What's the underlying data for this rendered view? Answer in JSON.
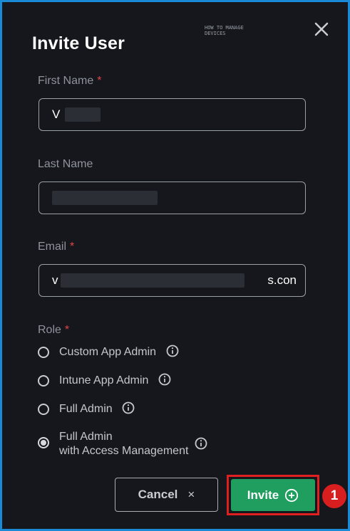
{
  "dialog": {
    "title": "Invite User",
    "watermark": "HOW TO MANAGE DEVICES"
  },
  "form": {
    "first_name": {
      "label": "First Name",
      "required_mark": "*",
      "value": "V"
    },
    "last_name": {
      "label": "Last Name",
      "required_mark": "",
      "value": ""
    },
    "email": {
      "label": "Email",
      "required_mark": "*",
      "value": "v",
      "value_tail": "s.con"
    },
    "role": {
      "label": "Role",
      "required_mark": "*",
      "options": [
        {
          "label": "Custom App Admin",
          "selected": false
        },
        {
          "label": "Intune App Admin",
          "selected": false
        },
        {
          "label": "Full Admin",
          "selected": false
        },
        {
          "label": "Full Admin with Access Management",
          "line1": "Full Admin",
          "line2": "with Access Management",
          "selected": true
        }
      ]
    }
  },
  "actions": {
    "cancel_label": "Cancel",
    "cancel_icon": "×",
    "invite_label": "Invite"
  },
  "annotation": {
    "step": "1"
  },
  "colors": {
    "background": "#15171c",
    "frame_border": "#1b8ad6",
    "invite_green": "#1f9e60",
    "highlight_red": "#e02020",
    "required_red": "#e0454a"
  },
  "icons": {
    "close": "close-icon",
    "info": "info-icon",
    "plus": "plus-circle-icon"
  }
}
